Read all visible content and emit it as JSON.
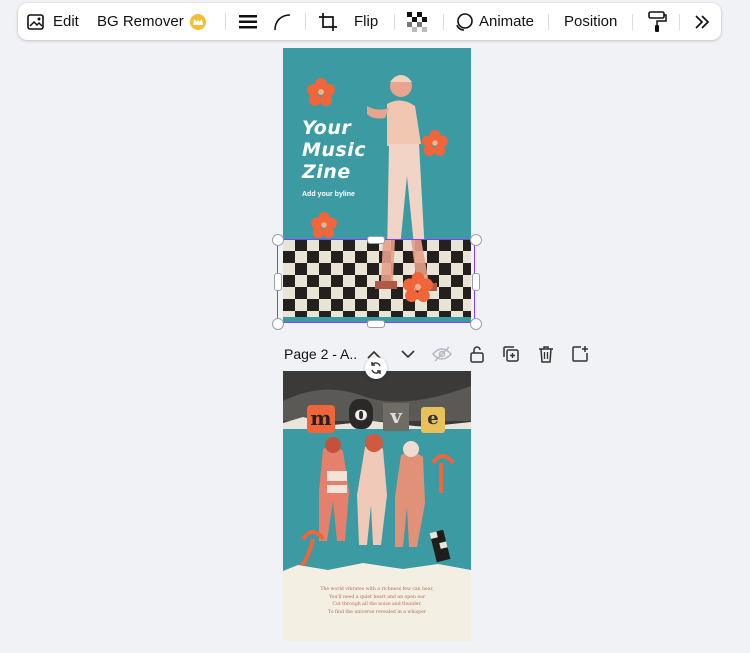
{
  "toolbar": {
    "edit_label": "Edit",
    "bg_remover_label": "BG Remover",
    "flip_label": "Flip",
    "animate_label": "Animate",
    "position_label": "Position"
  },
  "page1": {
    "title_lines": [
      "Your",
      "Music",
      "Zine"
    ],
    "byline": "Add your byline"
  },
  "page_bar": {
    "label": "Page 2 - A.."
  },
  "page2": {
    "letters": [
      "m",
      "o",
      "v",
      "e"
    ],
    "poem": [
      "The world vibrates with a richness few can hear,",
      "You'll need a quiet heart and an open ear",
      "Cut through all the noise and thunder,",
      "To find the universe revealed in a whisper"
    ]
  },
  "colors": {
    "accent": "#8b3dff",
    "page_bg": "#3c9aa3",
    "canvas_bg": "#f1f2f6"
  }
}
